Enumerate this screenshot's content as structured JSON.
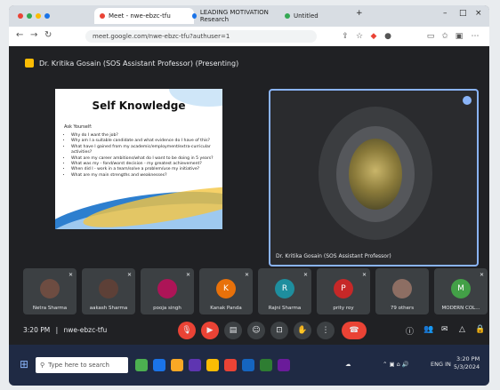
{
  "browser": {
    "tabs": [
      {
        "label": "Meet - nwe-ebzc-tfu",
        "color": "#ea4335",
        "active": true
      },
      {
        "label": "LEADING MOTIVATION Research",
        "color": "#1a73e8",
        "active": false
      },
      {
        "label": "Untitled",
        "color": "#34a853",
        "active": false
      }
    ],
    "new_tab": "+",
    "window_controls": [
      "–",
      "□",
      "×"
    ],
    "address": "meet.google.com/nwe-ebzc-tfu?authuser=1",
    "nav_icons": [
      "back-icon",
      "forward-icon",
      "reload-icon"
    ]
  },
  "meet": {
    "presenter_label": "Dr. Kritika Gosain (SOS Assistant Professor) (Presenting)",
    "slide": {
      "title": "Self Knowledge",
      "subtitle": "Ask Yourself:",
      "bullets": [
        "Why do I want the job?",
        "Why am I a suitable candidate and what evidence do I have of this?",
        "What have I gained from my academic/employment/extra-curricular activities?",
        "What are my career ambitions/what do I want to be doing in 5 years?",
        "What was my - fond/worst decision - my greatest achievement?",
        "When did I - work in a team/solve a problem/use my initiative?",
        "What are my main strengths and weaknesses?"
      ]
    },
    "active_tile_name": "Dr. Kritika Gosain (SOS Assistant Professor)",
    "participants": [
      {
        "name": "Netra Sharma",
        "initial": "",
        "color": "#6d4c41"
      },
      {
        "name": "aakash Sharma",
        "initial": "",
        "color": "#5d4037"
      },
      {
        "name": "pooja singh",
        "initial": "",
        "color": "#ad1457"
      },
      {
        "name": "Kanak Panda",
        "initial": "K",
        "color": "#e8710a"
      },
      {
        "name": "Rajni Sharma",
        "initial": "R",
        "color": "#1e8e9e"
      },
      {
        "name": "prity roy",
        "initial": "P",
        "color": "#c62828"
      },
      {
        "name": "79 others",
        "initial": "",
        "color": "#8d6e63"
      },
      {
        "name": "MODERN COL...",
        "initial": "M",
        "color": "#43a047"
      }
    ],
    "time": "3:20 PM",
    "meeting_code": "nwe-ebzc-tfu"
  },
  "taskbar": {
    "search_placeholder": "Type here to search",
    "date": "5/3/2024",
    "clock": "3:20 PM",
    "lang": "ENG IN"
  }
}
